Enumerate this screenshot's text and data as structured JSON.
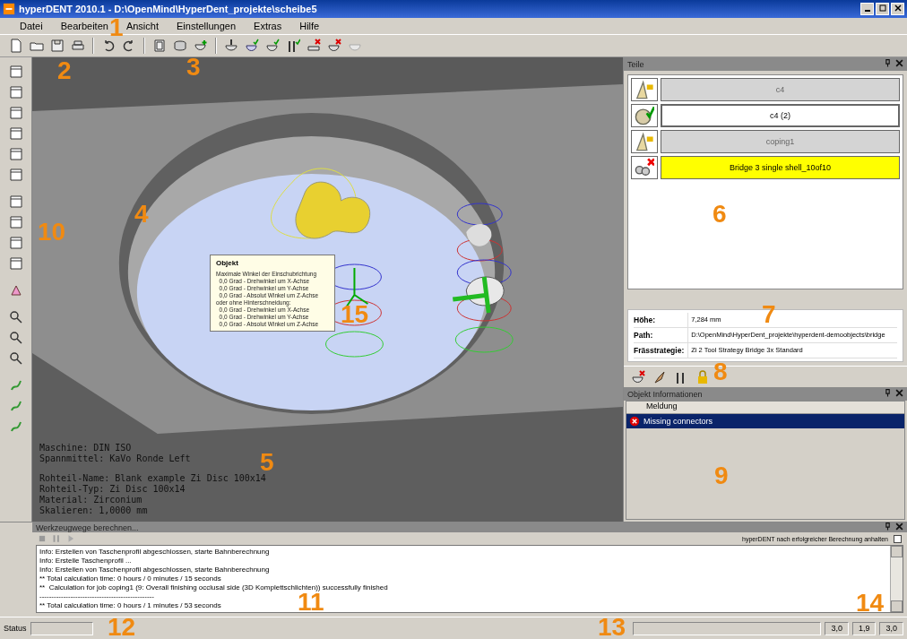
{
  "window": {
    "title": "hyperDENT 2010.1 - D:\\OpenMind\\HyperDent_projekte\\scheibe5"
  },
  "menu": [
    "Datei",
    "Bearbeiten",
    "Ansicht",
    "Einstellungen",
    "Extras",
    "Hilfe"
  ],
  "viewport": {
    "info_groups": [
      [
        "Maschine: DIN ISO",
        "Spannmittel: KaVo Ronde Left"
      ],
      [
        "Rohteil-Name: Blank example Zi Disc 100x14",
        "Rohteil-Typ: Zi Disc 100x14",
        "Material: Zirconium",
        "Skalieren: 1,0000 mm"
      ]
    ],
    "tooltip": {
      "title": "Objekt",
      "lines": [
        "Maximale Winkel der Einschubrichtung",
        "  0,0 Grad - Drehwinkel um X-Achse",
        "  0,0 Grad - Drehwinkel um Y-Achse",
        "  0,0 Grad - Absolut Winkel um Z-Achse",
        "oder ohne Hinterschneidung:",
        "  0,0 Grad - Drehwinkel um X-Achse",
        "  0,0 Grad - Drehwinkel um Y-Achse",
        "  0,0 Grad - Absolut Winkel um Z-Achse"
      ]
    }
  },
  "parts_panel": {
    "title": "Teile",
    "parts": [
      {
        "name": "c4",
        "kind": "locked",
        "selected": false
      },
      {
        "name": "c4 (2)",
        "kind": "ok",
        "selected": true
      },
      {
        "name": "coping1",
        "kind": "locked",
        "selected": false
      },
      {
        "name": "Bridge 3 single shell_10of10",
        "kind": "error",
        "selected": false
      }
    ]
  },
  "properties": [
    {
      "label": "Höhe:",
      "value": "7,284 mm"
    },
    {
      "label": "Path:",
      "value": "D:\\OpenMind\\HyperDent_projekte\\hyperdent-demoobjects\\bridge"
    },
    {
      "label": "Frässtrategie:",
      "value": "Zi 2 Tool Strategy Bridge 3x Standard"
    }
  ],
  "object_info": {
    "title": "Objekt Informationen",
    "column": "Meldung",
    "rows": [
      {
        "message": "Missing connectors",
        "selected": true
      }
    ]
  },
  "calc_panel": {
    "title": "Werkzeugwege berechnen...",
    "option": {
      "label": "hyperDENT nach erfolgreicher Berechnung anhalten",
      "checked": false
    },
    "log": [
      "Info: Erstellen von Taschenprofil abgeschlossen, starte Bahnberechnung",
      "Info: Erstelle Taschenprofil ...",
      "Info: Erstellen von Taschenprofil abgeschlossen, starte Bahnberechnung",
      "** Total calculation time: 0 hours / 0 minutes / 15 seconds",
      "**  Calculation for job coping1 (9: Overall finishing occlusal side (3D Komplettschlichten)) successfully finished",
      "------------------------------------------------",
      "** Total calculation time: 0 hours / 1 minutes / 53 seconds"
    ]
  },
  "status_bar": {
    "label": "Status",
    "cells": [
      "3,0",
      "1,9",
      "3,0"
    ]
  },
  "callouts": [
    "1",
    "2",
    "3",
    "4",
    "5",
    "6",
    "7",
    "8",
    "9",
    "10",
    "11",
    "12",
    "13",
    "14",
    "15"
  ]
}
